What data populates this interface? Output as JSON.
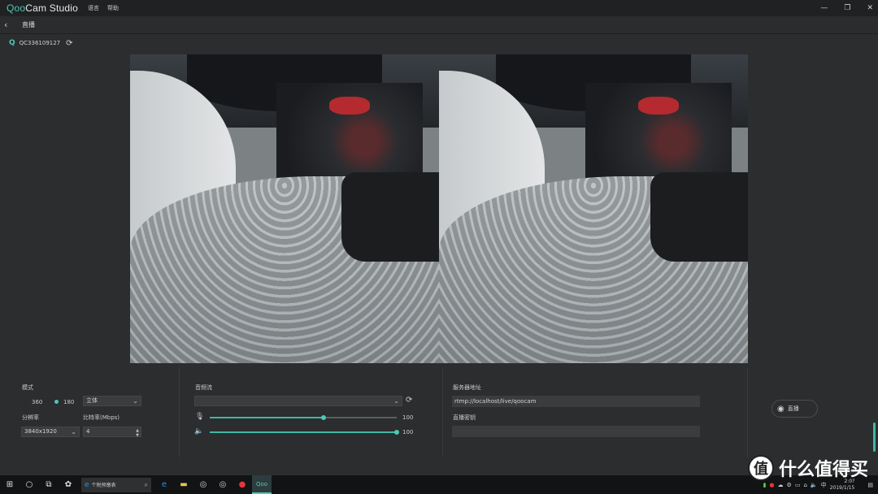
{
  "titlebar": {
    "logo_q": "Qoo",
    "logo_rest": "Cam Studio",
    "menu": [
      "语言",
      "帮助"
    ],
    "controls": {
      "minimize": "—",
      "restore": "❐",
      "close": "✕"
    }
  },
  "subheader": {
    "back": "‹",
    "title": "直播"
  },
  "device": {
    "prefix": "Q",
    "id": "QC336109127",
    "refresh": "⟳"
  },
  "settings": {
    "mode_label": "模式",
    "mode_options": [
      "360",
      "180"
    ],
    "mode_selected": "180",
    "stereo_value": "立体",
    "resolution_label": "分辨率",
    "resolution_value": "3840x1920",
    "bitrate_label": "比特率(Mbps)",
    "bitrate_value": "4"
  },
  "audio": {
    "label": "音频流",
    "source_value": "",
    "mic_value": "100",
    "mic_level": 0.61,
    "volume_value": "100",
    "volume_level": 1.0
  },
  "server": {
    "address_label": "服务器地址",
    "address_value": "rtmp://localhost/live/qoocam",
    "key_label": "直播密钥",
    "key_value": ""
  },
  "live_button": {
    "label": "直播"
  },
  "taskbar": {
    "search_placeholder": "个税预缴表",
    "clock_time": "2:0?",
    "clock_date": "2019/1/15",
    "ime": "中"
  },
  "watermark": {
    "text": "什么值得买",
    "badge": "值"
  },
  "colors": {
    "accent": "#4fc7b6",
    "background": "#2b2d2e",
    "titlebar": "#1f2122"
  }
}
